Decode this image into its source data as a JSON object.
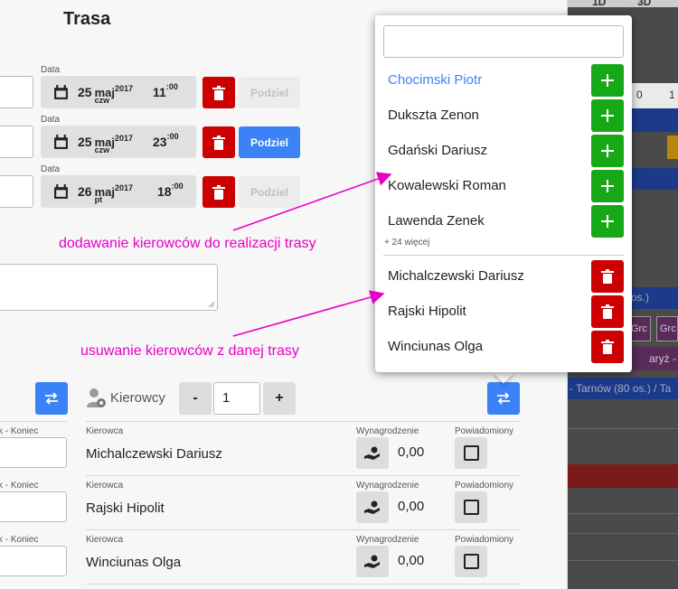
{
  "header": {
    "title": "Trasa"
  },
  "calendar": {
    "top_labels": [
      "1D",
      "3D"
    ],
    "hour_labels": [
      "0",
      "1"
    ],
    "snippets": [
      "os.)",
      "Grc",
      "Grc",
      "aryż - M",
      "- Tarnów (80 os.) / Ta"
    ]
  },
  "dates": {
    "label": "Data",
    "split_label": "Podziel",
    "rows": [
      {
        "day": "25",
        "month": "maj",
        "year": "2017",
        "dow": "czw",
        "hour": "11",
        "min": ":00"
      },
      {
        "day": "25",
        "month": "maj",
        "year": "2017",
        "dow": "czw",
        "hour": "23",
        "min": ":00"
      },
      {
        "day": "26",
        "month": "maj",
        "year": "2017",
        "dow": "pt",
        "hour": "18",
        "min": ":00"
      }
    ]
  },
  "annotations": {
    "add_drivers": "dodawanie kierowców do realizacji trasy",
    "remove_drivers": "usuwanie kierowców z danej trasy"
  },
  "drivers": {
    "label": "Kierowcy",
    "count": "1",
    "minus": "-",
    "plus": "+",
    "col_driver": "Kierowca",
    "col_pay": "Wynagrodzenie",
    "col_notified": "Powiadomiony",
    "left_col": "k - Koniec",
    "rows": [
      {
        "name": "Michalczewski Dariusz",
        "pay": "0,00"
      },
      {
        "name": "Rajski Hipolit",
        "pay": "0,00"
      },
      {
        "name": "Winciunas Olga",
        "pay": "0,00"
      }
    ]
  },
  "popup": {
    "search_value": "",
    "available": [
      {
        "name": "Chocimski Piotr",
        "highlighted": true
      },
      {
        "name": "Dukszta Zenon"
      },
      {
        "name": "Gdański Dariusz"
      },
      {
        "name": "Kowalewski Roman"
      },
      {
        "name": "Lawenda Zenek"
      }
    ],
    "more_label": "+ 24 więcej",
    "assigned": [
      {
        "name": "Michalczewski Dariusz"
      },
      {
        "name": "Rajski Hipolit"
      },
      {
        "name": "Winciunas Olga"
      }
    ]
  },
  "colors": {
    "accent": "#3b82f6",
    "danger": "#cc0000",
    "success": "#16a816",
    "annotation": "#e600c8"
  }
}
